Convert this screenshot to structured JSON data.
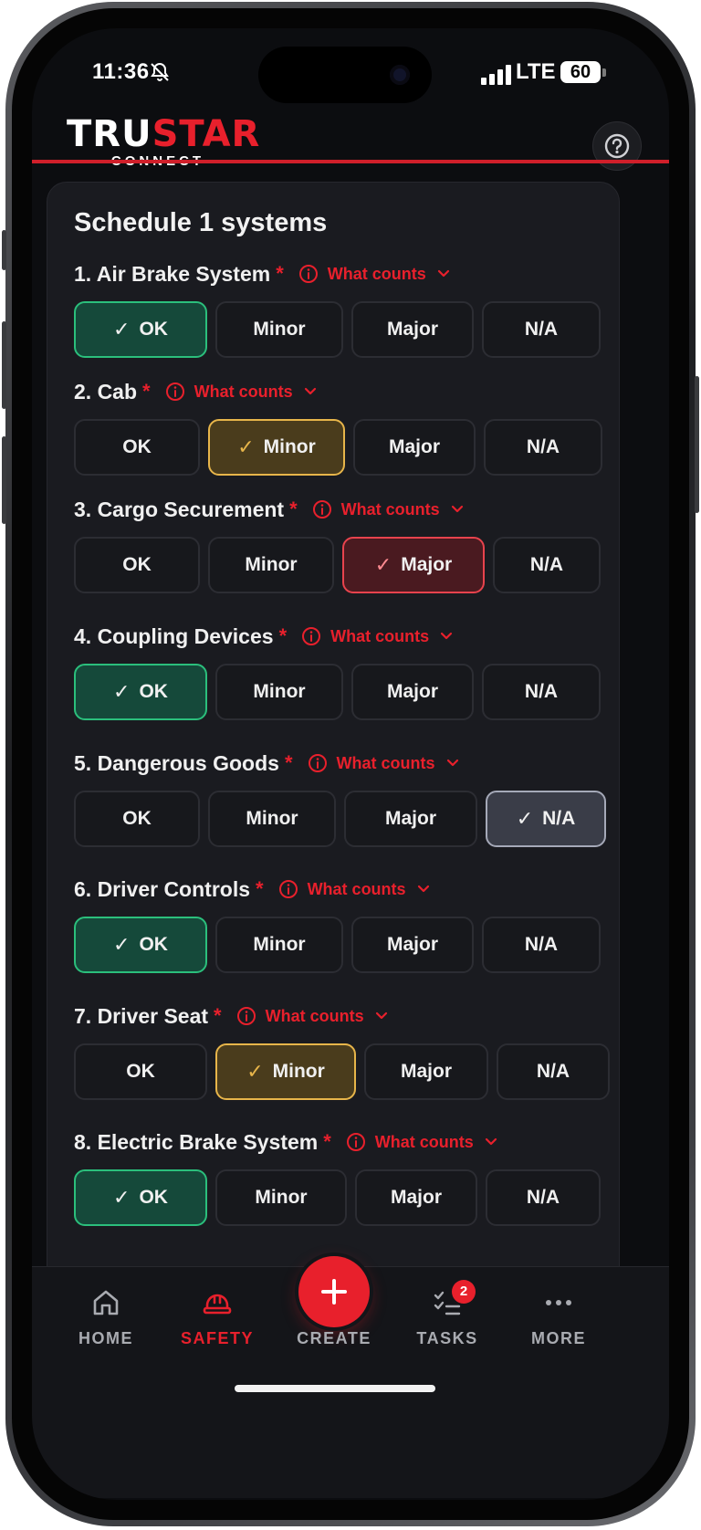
{
  "status_bar": {
    "time": "11:36",
    "network": "LTE",
    "battery": "60"
  },
  "header": {
    "logo_part1": "TRU",
    "logo_part2": "STAR",
    "logo_sub": "CONNECT"
  },
  "card": {
    "title": "Schedule 1 systems"
  },
  "what_counts_label": "What counts",
  "required_mark": "*",
  "options": {
    "ok": "OK",
    "minor": "Minor",
    "major": "Major",
    "na": "N/A"
  },
  "questions": [
    {
      "label": "1. Air Brake System",
      "selected": "OK"
    },
    {
      "label": "2. Cab",
      "selected": "Minor"
    },
    {
      "label": "3. Cargo Securement",
      "selected": "Major"
    },
    {
      "label": "4. Coupling Devices",
      "selected": "OK"
    },
    {
      "label": "5. Dangerous Goods",
      "selected": "N/A"
    },
    {
      "label": "6. Driver Controls",
      "selected": "OK"
    },
    {
      "label": "7. Driver Seat",
      "selected": "Minor"
    },
    {
      "label": "8. Electric Brake System",
      "selected": "OK"
    }
  ],
  "nav": {
    "home": "HOME",
    "safety": "SAFETY",
    "create": "CREATE",
    "tasks": "TASKS",
    "tasks_badge": "2",
    "more": "MORE",
    "active": "SAFETY"
  },
  "colors": {
    "accent": "#e8202c",
    "ok_selected": "#2bbf7c",
    "minor_selected": "#e7b54a",
    "major_selected": "#e8434d",
    "na_selected": "#a5a9b8"
  },
  "icons": [
    "bell-slash-icon",
    "signal-icon",
    "help-icon",
    "info-icon",
    "chevron-down-icon",
    "check-icon",
    "home-icon",
    "hard-hat-icon",
    "plus-icon",
    "tasks-checklist-icon",
    "more-dots-icon"
  ]
}
